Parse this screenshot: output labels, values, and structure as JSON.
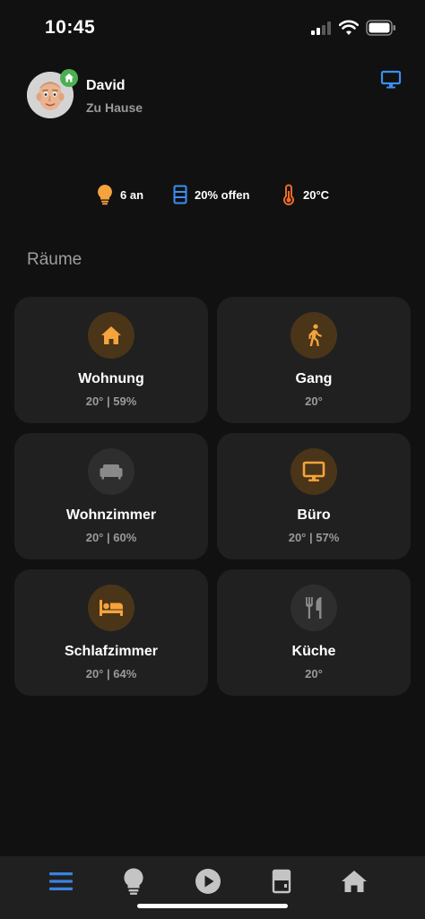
{
  "status_bar": {
    "time": "10:45"
  },
  "header": {
    "user_name": "David",
    "user_status": "Zu Hause"
  },
  "summary": {
    "lights": "6 an",
    "covers": "20% offen",
    "temperature": "20°C"
  },
  "section_title": "Räume",
  "rooms": [
    {
      "name": "Wohnung",
      "sub": "20° | 59%",
      "icon": "home-icon",
      "active": true
    },
    {
      "name": "Gang",
      "sub": "20°",
      "icon": "walk-icon",
      "active": true
    },
    {
      "name": "Wohnzimmer",
      "sub": "20° | 60%",
      "icon": "sofa-icon",
      "active": false
    },
    {
      "name": "Büro",
      "sub": "20° | 57%",
      "icon": "monitor-icon",
      "active": true
    },
    {
      "name": "Schlafzimmer",
      "sub": "20° | 64%",
      "icon": "bed-icon",
      "active": true
    },
    {
      "name": "Küche",
      "sub": "20°",
      "icon": "cutlery-icon",
      "active": false
    }
  ],
  "tabs": [
    {
      "name": "menu-icon",
      "active": true
    },
    {
      "name": "lightbulb-icon",
      "active": false
    },
    {
      "name": "play-icon",
      "active": false
    },
    {
      "name": "cover-icon",
      "active": false
    },
    {
      "name": "home-icon",
      "active": false
    }
  ],
  "colors": {
    "accent_orange": "#f5a33d",
    "accent_blue": "#3d8ef0",
    "temp_orange": "#f06a2a",
    "active_tab_blue": "#3b82e0",
    "background": "#111111",
    "card": "#202020"
  }
}
